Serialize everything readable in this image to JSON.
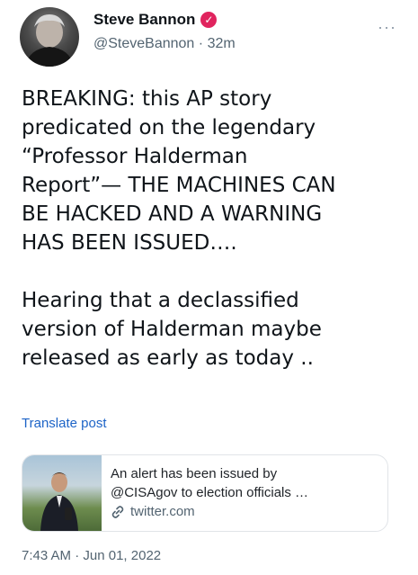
{
  "author": {
    "name": "Steve Bannon",
    "handle": "@SteveBannon",
    "age": "32m",
    "separator": "·",
    "verified_color": "#e0245e"
  },
  "more_icon": "···",
  "tweet": {
    "text": "BREAKING: this AP story\npredicated on the legendary\n“Professor Halderman\nReport”— THE MACHINES CAN\nBE HACKED AND A WARNING\nHAS BEEN ISSUED….\n\nHearing that a declassified\nversion of Halderman maybe\nreleased as early as today .."
  },
  "translate_label": "Translate post",
  "card": {
    "line1": "An alert has been issued by",
    "line2": "@CISAgov to election officials …",
    "domain": "twitter.com"
  },
  "timestamp": {
    "time": "7:43 AM",
    "separator": "·",
    "date": "Jun 01, 2022"
  },
  "colors": {
    "link": "#1d64c7",
    "secondary_text": "#536471"
  }
}
